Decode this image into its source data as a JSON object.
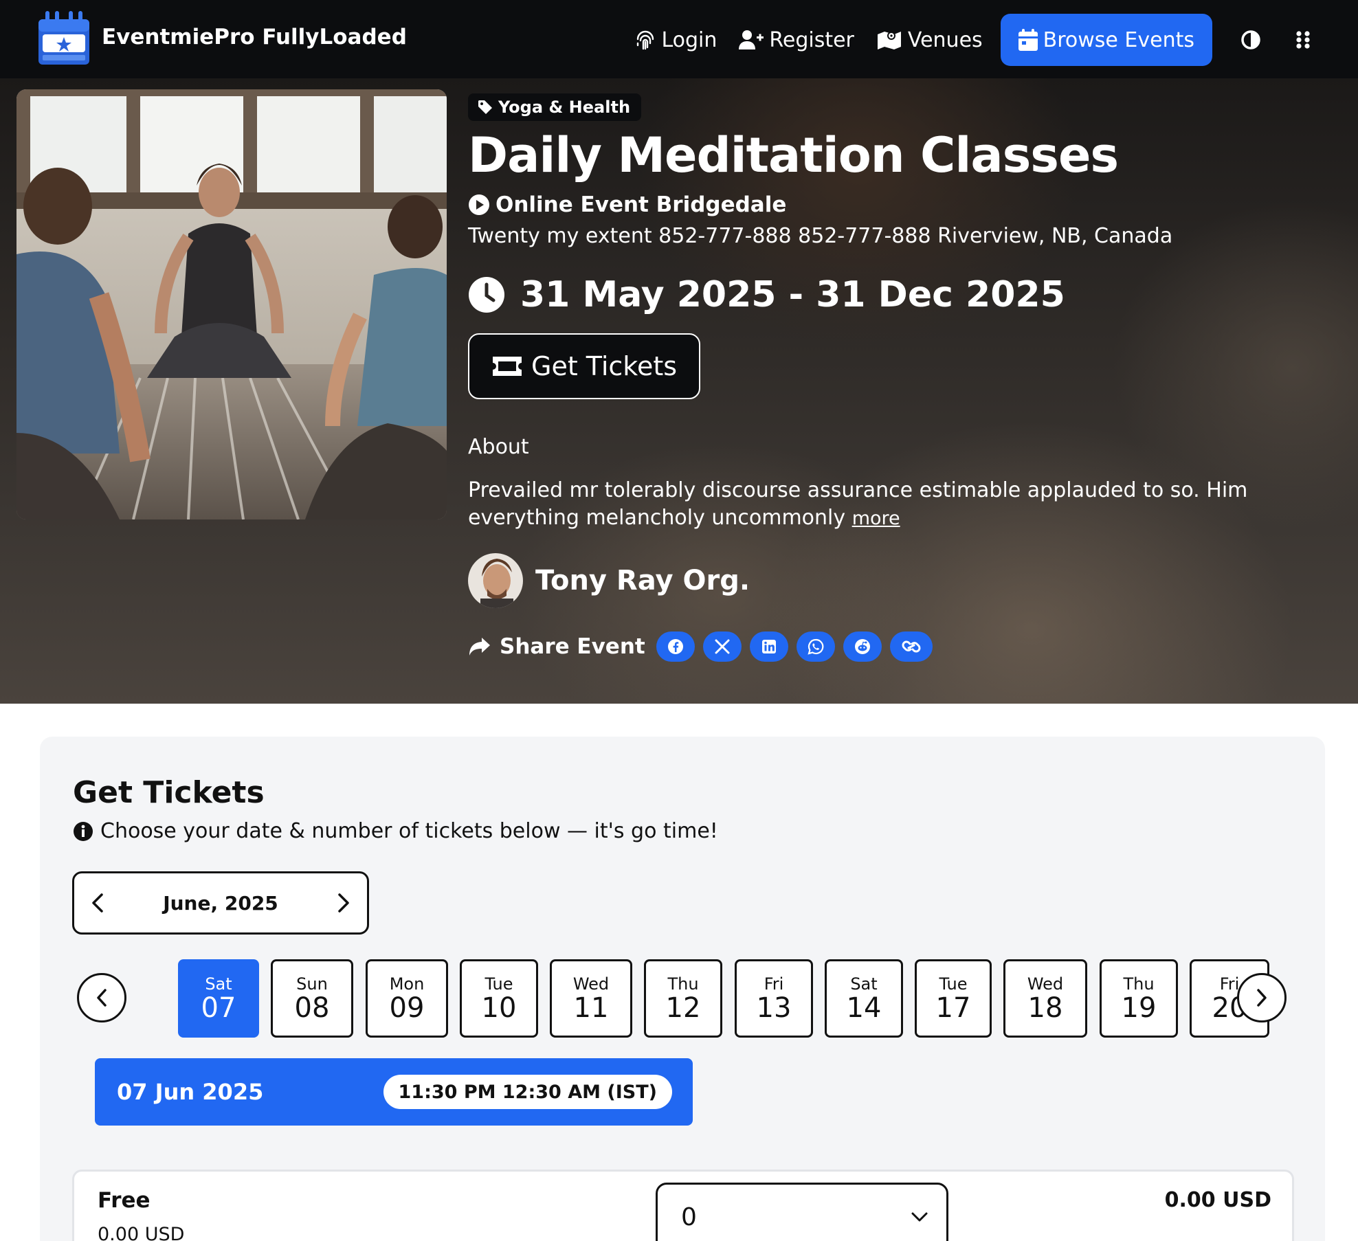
{
  "nav": {
    "brand": "EventmiePro FullyLoaded",
    "login": "Login",
    "register": "Register",
    "venues": "Venues",
    "browse": "Browse Events",
    "accent": "#2168f2"
  },
  "hero": {
    "category": "Yoga & Health",
    "title": "Daily Meditation Classes",
    "venue": "Online Event Bridgedale",
    "address": "Twenty my extent 852-777-888 852-777-888 Riverview, NB, Canada",
    "date_range": "31 May 2025 - 31 Dec 2025",
    "get_tickets": "Get Tickets",
    "about_label": "About",
    "about_text": "Prevailed mr tolerably discourse assurance estimable applauded to so. Him everything melancholy uncommonly",
    "about_more": "more",
    "organizer": "Tony Ray Org.",
    "share_label": "Share Event",
    "share_icons": [
      "facebook-icon",
      "x-icon",
      "linkedin-icon",
      "whatsapp-icon",
      "reddit-icon",
      "link-icon"
    ]
  },
  "tickets": {
    "title": "Get Tickets",
    "subtitle": "Choose your date & number of tickets below — it's go time!",
    "month": "June, 2025",
    "days": [
      {
        "name": "Sat",
        "num": "07",
        "active": true
      },
      {
        "name": "Sun",
        "num": "08",
        "active": false
      },
      {
        "name": "Mon",
        "num": "09",
        "active": false
      },
      {
        "name": "Tue",
        "num": "10",
        "active": false
      },
      {
        "name": "Wed",
        "num": "11",
        "active": false
      },
      {
        "name": "Thu",
        "num": "12",
        "active": false
      },
      {
        "name": "Fri",
        "num": "13",
        "active": false
      },
      {
        "name": "Sat",
        "num": "14",
        "active": false
      },
      {
        "name": "Tue",
        "num": "17",
        "active": false
      },
      {
        "name": "Wed",
        "num": "18",
        "active": false
      },
      {
        "name": "Thu",
        "num": "19",
        "active": false
      },
      {
        "name": "Fri",
        "num": "20",
        "active": false
      }
    ],
    "selected_date": "07 Jun 2025",
    "selected_time": "11:30 PM 12:30 AM (IST)",
    "ticket": {
      "name": "Free",
      "price": "0.00 USD",
      "quantity": "0",
      "total": "0.00 USD"
    }
  }
}
